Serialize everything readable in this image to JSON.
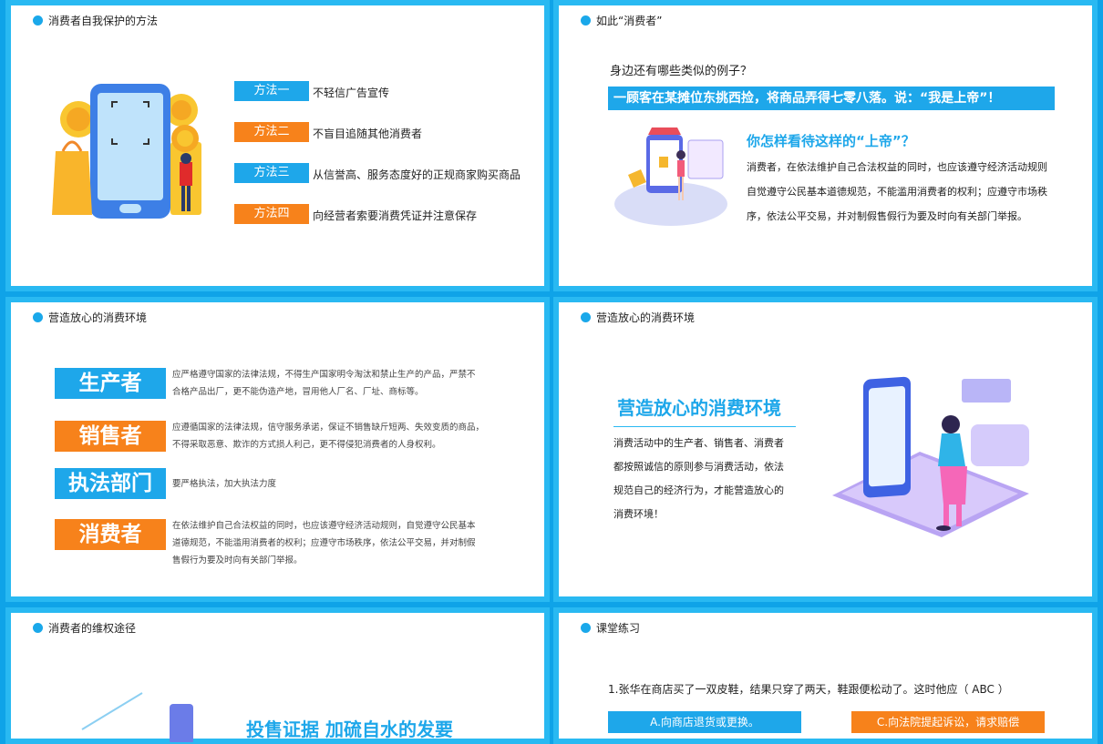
{
  "colors": {
    "blue": "#1ea7ea",
    "orange": "#f7821b",
    "frame": "#29b9f2"
  },
  "slide1": {
    "title": "消费者自我保护的方法",
    "methods": [
      {
        "tag": "方法一",
        "text": "不轻信广告宣传"
      },
      {
        "tag": "方法二",
        "text": "不盲目追随其他消费者"
      },
      {
        "tag": "方法三",
        "text": "从信誉高、服务态度好的正规商家购买商品"
      },
      {
        "tag": "方法四",
        "text": "向经营者索要消费凭证并注意保存"
      }
    ]
  },
  "slide2": {
    "title": "如此“消费者”",
    "question": "身边还有哪些类似的例子？",
    "banner": "一顾客在某摊位东挑西捡，将商品弄得七零八落。说：“我是上帝”！",
    "subtitle": "你怎样看待这样的“上帝”？",
    "lines": [
      "消费者，在依法维护自己合法权益的同时，也应该遵守经济活动规则",
      "自觉遵守公民基本道德规范，不能滥用消费者的权利；应遵守市场秩",
      "序，依法公平交易，并对制假售假行为要及时向有关部门举报。"
    ]
  },
  "slide3": {
    "title": "营造放心的消费环境",
    "roles": [
      {
        "name": "生产者",
        "lines": [
          "应严格遵守国家的法律法规，不得生产国家明令淘汰和禁止生产的产品，严禁不",
          "合格产品出厂，更不能伪造产地，冒用他人厂名、厂址、商标等。"
        ]
      },
      {
        "name": "销售者",
        "lines": [
          "应遵循国家的法律法规，信守服务承诺，保证不销售缺斤短两、失效变质的商品，",
          "不得采取恶意、欺诈的方式损人利己，更不得侵犯消费者的人身权利。"
        ]
      },
      {
        "name": "执法部门",
        "lines": [
          "要严格执法，加大执法力度"
        ]
      },
      {
        "name": "消费者",
        "lines": [
          "在依法维护自己合法权益的同时，也应该遵守经济活动规则，自觉遵守公民基本",
          "道德规范，不能滥用消费者的权利；应遵守市场秩序，依法公平交易，并对制假",
          "售假行为要及时向有关部门举报。"
        ]
      }
    ]
  },
  "slide4": {
    "title": "营造放心的消费环境",
    "heading": "营造放心的消费环境",
    "lines": [
      "消费活动中的生产者、销售者、消费者",
      "都按照诚信的原则参与消费活动，依法",
      "规范自己的经济行为，才能营造放心的",
      "消费环境！"
    ]
  },
  "slide5": {
    "title": "消费者的维权途径",
    "partial_heading": "投售证据  加硫自水的发要"
  },
  "slide6": {
    "title": "课堂练习",
    "question": "1.张华在商店买了一双皮鞋，结果只穿了两天，鞋跟便松动了。这时他应（   ABC  ）",
    "optA": "A.向商店退货或更换。",
    "optC": "C.向法院提起诉讼，请求赔偿"
  }
}
